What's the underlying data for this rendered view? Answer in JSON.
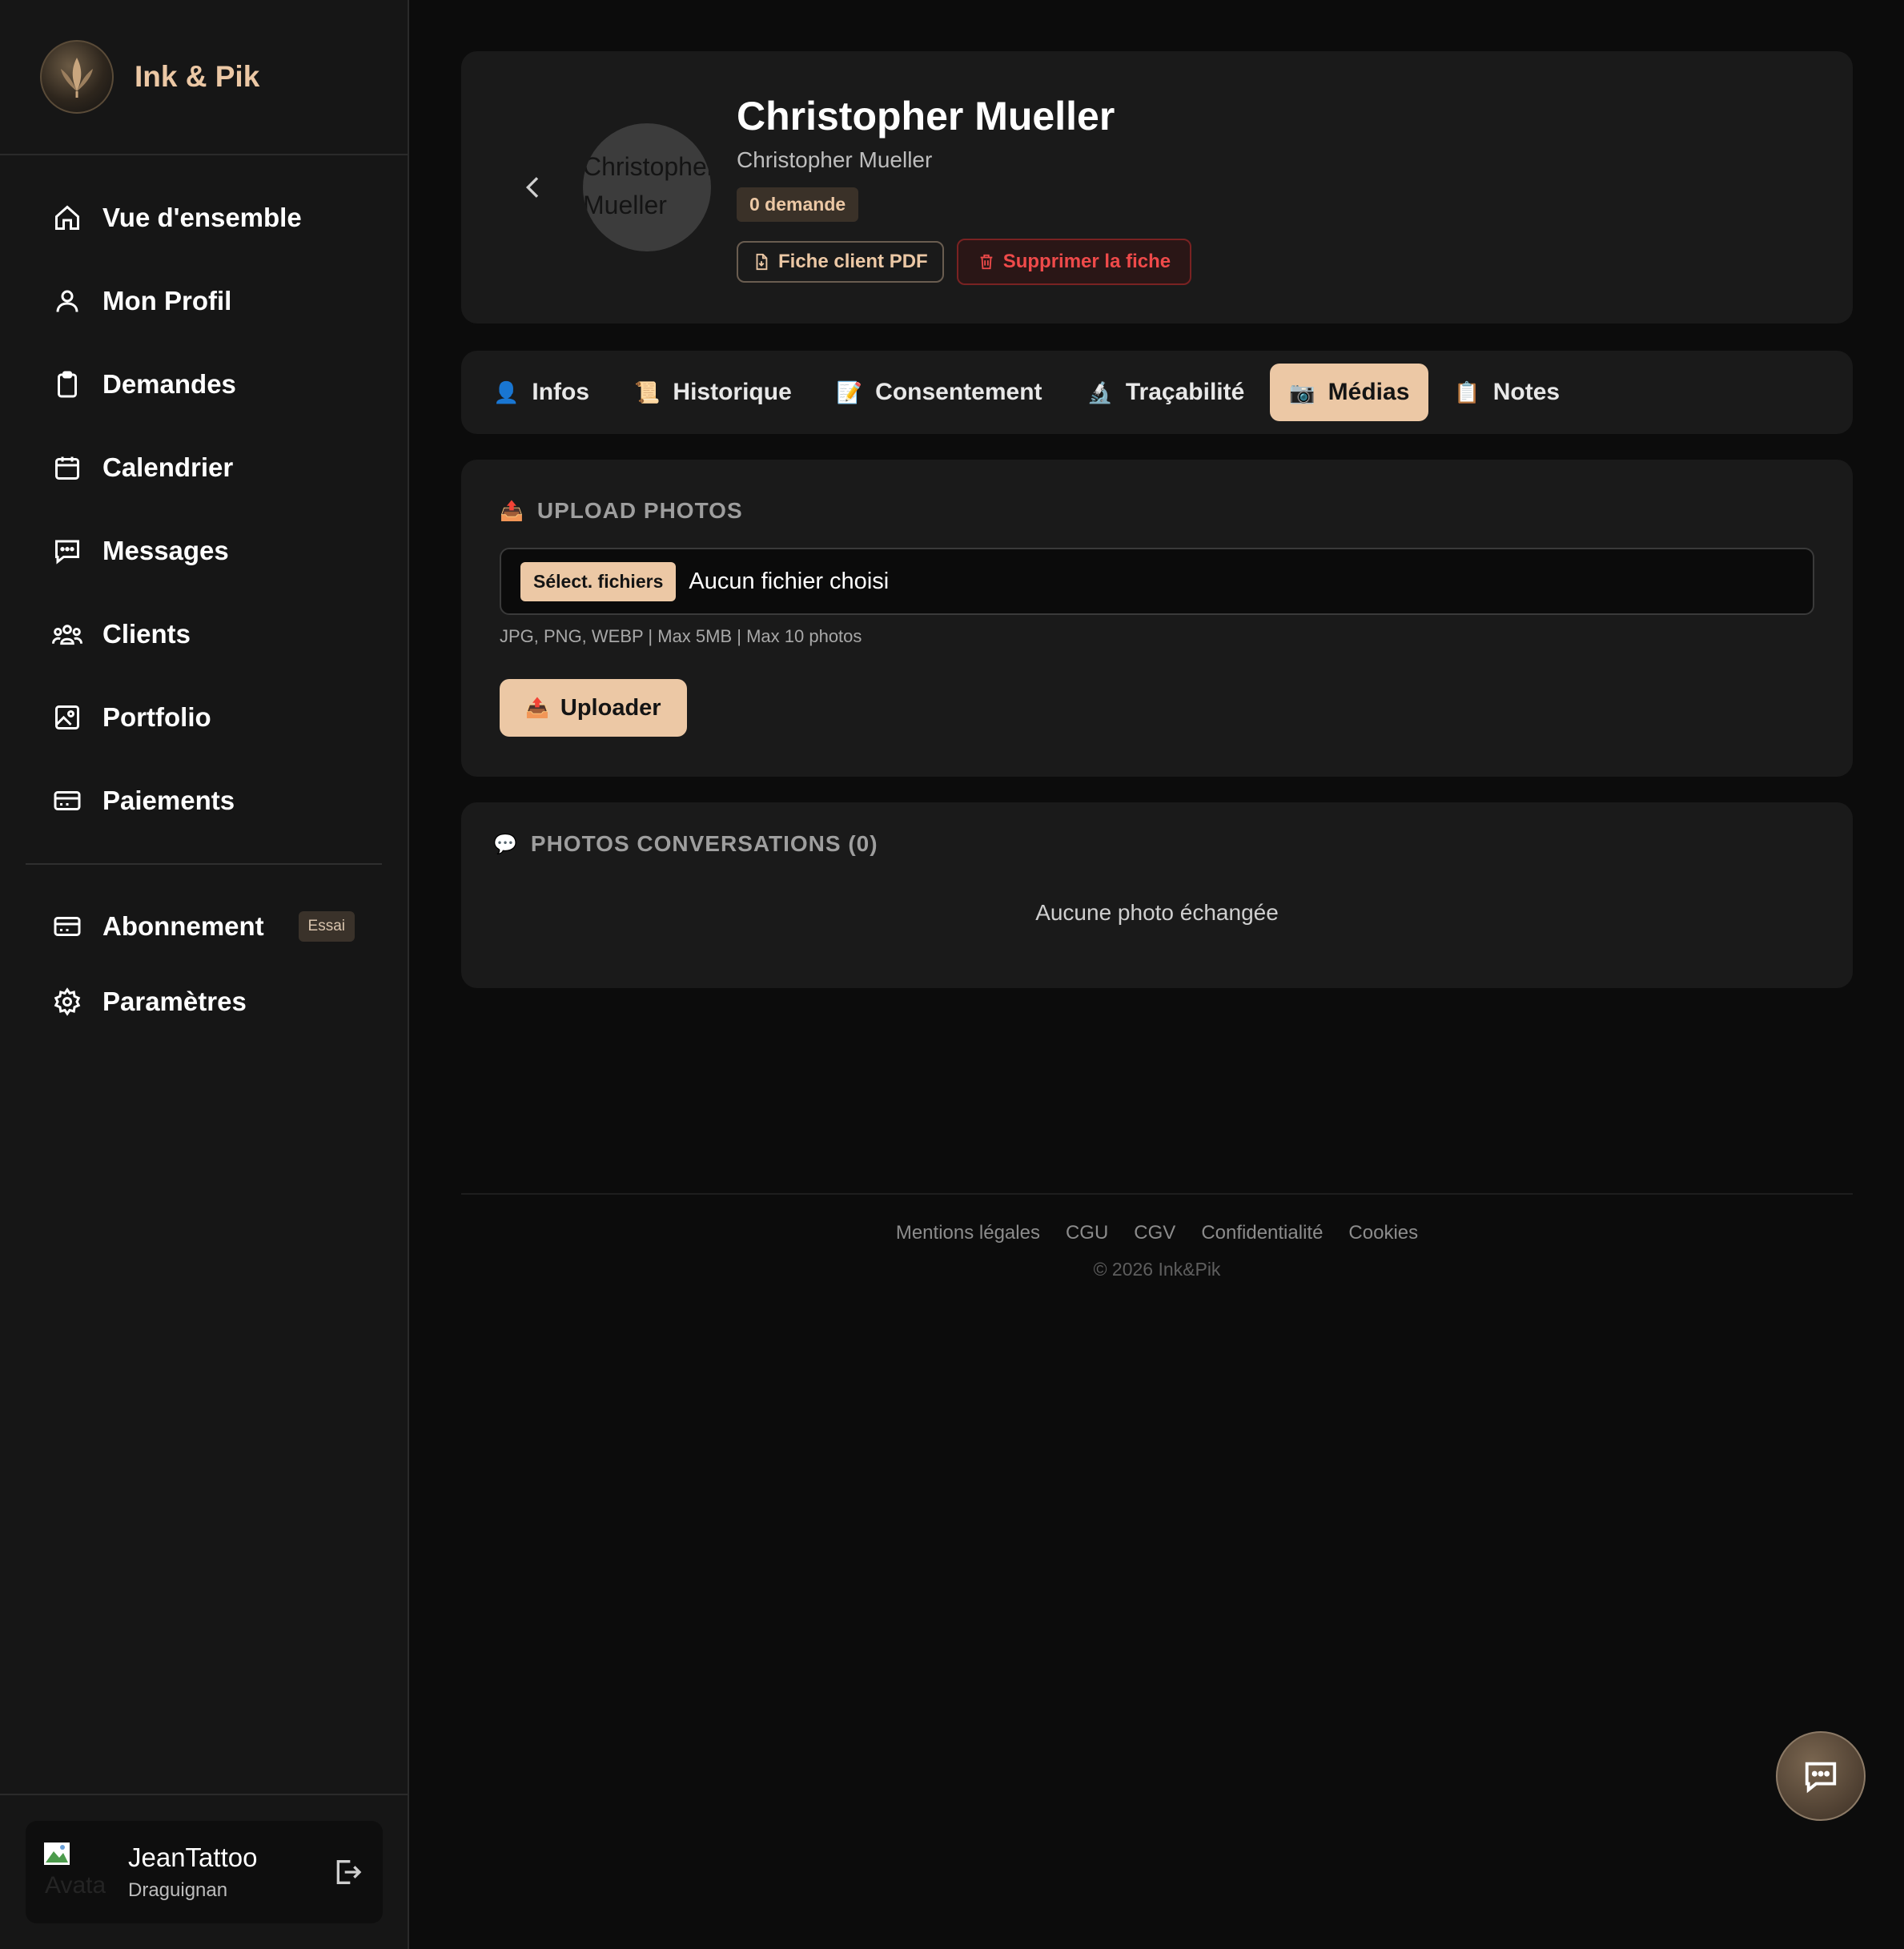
{
  "brand": {
    "name": "Ink & Pik",
    "logo_icon": "feather-logo-icon"
  },
  "sidebar": {
    "items": [
      {
        "label": "Vue d'ensemble",
        "icon": "home-icon"
      },
      {
        "label": "Mon Profil",
        "icon": "user-icon"
      },
      {
        "label": "Demandes",
        "icon": "clipboard-icon"
      },
      {
        "label": "Calendrier",
        "icon": "calendar-icon"
      },
      {
        "label": "Messages",
        "icon": "message-icon"
      },
      {
        "label": "Clients",
        "icon": "users-icon"
      },
      {
        "label": "Portfolio",
        "icon": "image-icon"
      },
      {
        "label": "Paiements",
        "icon": "credit-card-icon"
      }
    ],
    "secondary": [
      {
        "label": "Abonnement",
        "icon": "credit-card-icon",
        "badge": "Essai"
      },
      {
        "label": "Paramètres",
        "icon": "gear-icon"
      }
    ]
  },
  "user": {
    "avatar_alt": "Avatar",
    "name": "JeanTattoo",
    "city": "Draguignan"
  },
  "client": {
    "avatar_alt_line1": "Christopher",
    "avatar_alt_line2": "Mueller",
    "name": "Christopher Mueller",
    "subtitle": "Christopher Mueller",
    "badge": "0 demande",
    "pdf_label": "Fiche client PDF",
    "delete_label": "Supprimer la fiche"
  },
  "tabs": [
    {
      "emoji": "👤",
      "label": "Infos",
      "active": false
    },
    {
      "emoji": "📜",
      "label": "Historique",
      "active": false
    },
    {
      "emoji": "📝",
      "label": "Consentement",
      "active": false
    },
    {
      "emoji": "🔬",
      "label": "Traçabilité",
      "active": false
    },
    {
      "emoji": "📷",
      "label": "Médias",
      "active": true
    },
    {
      "emoji": "📋",
      "label": "Notes",
      "active": false
    }
  ],
  "upload": {
    "emoji": "📤",
    "title": "UPLOAD PHOTOS",
    "file_button": "Sélect. fichiers",
    "file_status": "Aucun fichier choisi",
    "hint": "JPG, PNG, WEBP | Max 5MB | Max 10 photos",
    "button_emoji": "📤",
    "button_label": "Uploader"
  },
  "photos": {
    "emoji": "💬",
    "title": "PHOTOS CONVERSATIONS (0)",
    "empty": "Aucune photo échangée"
  },
  "footer": {
    "links": [
      "Mentions légales",
      "CGU",
      "CGV",
      "Confidentialité",
      "Cookies"
    ],
    "copyright": "© 2026 Ink&Pik"
  },
  "colors": {
    "accent": "#ecc8a5",
    "danger": "#ef4a4a",
    "sidebar_bg": "#161616",
    "card_bg": "#1a1a1a",
    "page_bg": "#0c0c0c"
  }
}
